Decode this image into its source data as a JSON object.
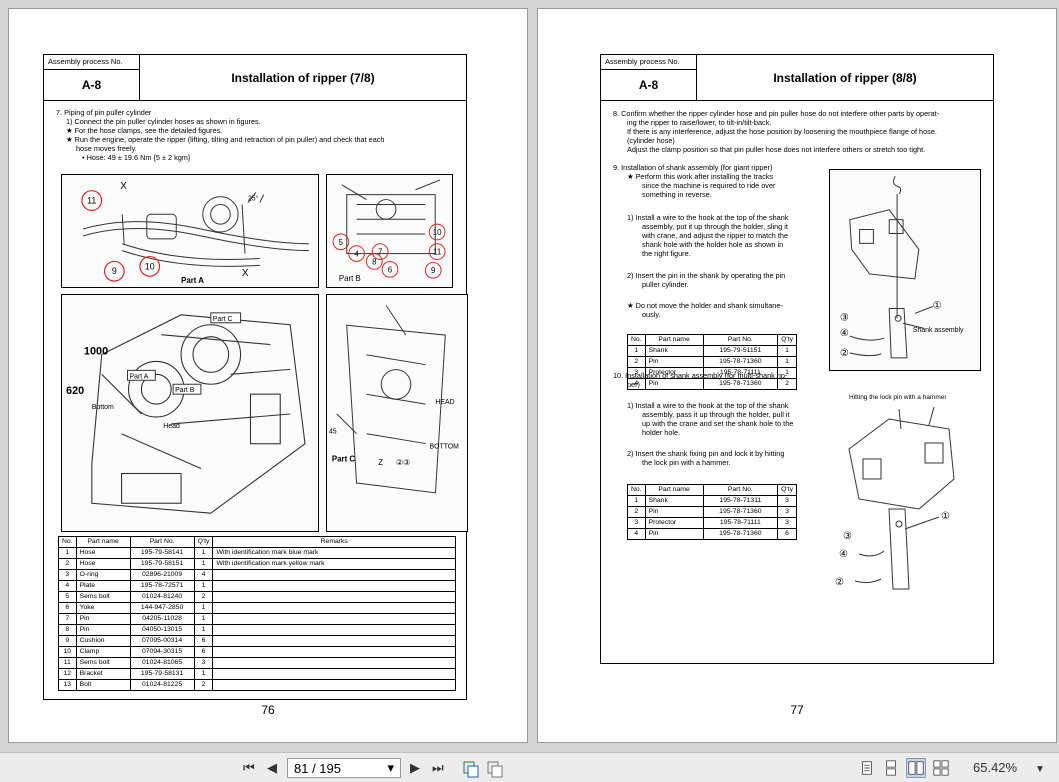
{
  "left_page": {
    "header_label": "Assembly process No.",
    "process_code": "A-8",
    "title": "Installation of ripper (7/8)",
    "step7": {
      "title": "7.   Piping of pin puller cylinder",
      "l1": "1)  Connect the pin puller cylinder hoses as shown in figures.",
      "l2": "★  For the hose clamps, see the detailed figures.",
      "l3": "★  Run the engine, operate the ripper (lifting, tilting and retraction of pin puller) and check that each",
      "l4": "hose moves freely.",
      "l5": "• Hose: 49 ± 19.6 Nm {5 ± 2 kgm}"
    },
    "fig_a": {
      "label": "Part A",
      "x": "X",
      "x2": "X",
      "angle": "25°",
      "c11": "11",
      "c9": "9",
      "c10": "10"
    },
    "fig_b": {
      "label": "Part B",
      "c5": "5",
      "c4": "4",
      "c7": "7",
      "c8": "8",
      "c6": "6",
      "c10": "10",
      "c11": "11",
      "c9": "9"
    },
    "fig_main": {
      "dim1000": "1000",
      "dim620": "620",
      "part_a": "Part A",
      "part_b": "Part B",
      "part_c": "Part C",
      "bottom": "Bottom",
      "head": "Head"
    },
    "fig_c": {
      "label": "Part C",
      "head": "HEAD",
      "bottom": "BOTTOM",
      "z": "Z",
      "n45": "45",
      "nums": "②③"
    },
    "table": {
      "headers": [
        "No.",
        "Part name",
        "Part No.",
        "Q'ty",
        "Remarks"
      ],
      "rows": [
        [
          "1",
          "Hose",
          "195-79-58141",
          "1",
          "With identification mark blue mark"
        ],
        [
          "2",
          "Hose",
          "195-79-58151",
          "1",
          "With identification mark yellow mark"
        ],
        [
          "3",
          "O-ring",
          "02896-21009",
          "4",
          ""
        ],
        [
          "4",
          "Plate",
          "195-78-72571",
          "1",
          ""
        ],
        [
          "5",
          "Sems bolt",
          "01024-81240",
          "2",
          ""
        ],
        [
          "6",
          "Yoke",
          "144-947-2850",
          "1",
          ""
        ],
        [
          "7",
          "Pin",
          "04205-11028",
          "1",
          ""
        ],
        [
          "8",
          "Pin",
          "04050-13015",
          "1",
          ""
        ],
        [
          "9",
          "Cushion",
          "07095-00314",
          "6",
          ""
        ],
        [
          "10",
          "Clamp",
          "07094-30315",
          "6",
          ""
        ],
        [
          "11",
          "Sems bolt",
          "01024-81065",
          "3",
          ""
        ],
        [
          "12",
          "Bracket",
          "195-79-58131",
          "1",
          ""
        ],
        [
          "13",
          "Bolt",
          "01024-81225",
          "2",
          ""
        ]
      ]
    },
    "page_number": "76"
  },
  "right_page": {
    "header_label": "Assembly process No.",
    "process_code": "A-8",
    "title": "Installation of ripper (8/8)",
    "step8": {
      "l1": "8.   Confirm whether the ripper cylinder hose and pin puller hose do not interfere other parts by operat-",
      "l2": "ing the ripper to raise/lower, to tilt-in/tilt-back.",
      "l3": "If there is any interference, adjust the hose position by loosening the mouthpiece flange of hose.",
      "l4": "(cylinder hose)",
      "l5": "Adjust the clamp position so that pin puller hose does not interfere others or stretch too tight."
    },
    "step9": {
      "title": "9.   Installation of shank assembly (for giant ripper)",
      "s1": [
        "★  Perform this work after installing the tracks",
        "since the machine is required to ride over",
        "something in reverse."
      ],
      "s2": [
        "1)  Install a wire to the hook at the top of the shank",
        "assembly, put it up through the holder, sling it",
        "with crane, and adjust the ripper to match the",
        "shank hole with the holder hole as shown in",
        "the right figure."
      ],
      "s3": [
        "2)  Insert the pin in the shank by operating the pin",
        "puller cylinder."
      ],
      "s4": [
        "★  Do not move the holder and shank simultane-",
        "ously."
      ]
    },
    "table1": {
      "headers": [
        "No.",
        "Part name",
        "Part No.",
        "Q'ty"
      ],
      "rows": [
        [
          "1",
          "Shank",
          "195-79-51151",
          "1"
        ],
        [
          "2",
          "Pin",
          "195-78-71360",
          "1"
        ],
        [
          "3",
          "Protector",
          "195-78-71111",
          "1"
        ],
        [
          "4",
          "Pin",
          "195-78-71360",
          "2"
        ]
      ]
    },
    "fig1": {
      "label": "Shank assembly",
      "n1": "①",
      "n2": "②",
      "n3": "③",
      "n4": "④"
    },
    "step10": {
      "title": [
        "10.  Installation of shank assembly (for multi-shank rip-",
        "per)"
      ],
      "s1": [
        "1)  Install a wire to the hook at the top of the shank",
        "assembly, pass it up through the holder, pull it",
        "up with the crane and set the shank hole to the",
        "holder hole."
      ],
      "s2": [
        "2)  Insert the shank fixing pin and lock it by hitting",
        "the lock pin with a hammer."
      ]
    },
    "table2": {
      "headers": [
        "No.",
        "Part name",
        "Part No.",
        "Q'ty"
      ],
      "rows": [
        [
          "1",
          "Shank",
          "195-78-71311",
          "3"
        ],
        [
          "2",
          "Pin",
          "195-78-71360",
          "3"
        ],
        [
          "3",
          "Protector",
          "195-78-71111",
          "3"
        ],
        [
          "4",
          "Pin",
          "195-78-71360",
          "6"
        ]
      ]
    },
    "fig2": {
      "label": "Hitting the lock pin with a hammer",
      "n1": "①",
      "n2": "②",
      "n3": "③",
      "n4": "④"
    },
    "page_number": "77"
  },
  "toolbar": {
    "first": "⏮",
    "prev": "◀",
    "page_value": "81 / 195",
    "dropdown": "▾",
    "next": "▶",
    "last": "⏭",
    "zoom": "65.42%",
    "icons": [
      "first-page-icon",
      "previous-page-icon",
      "next-page-icon",
      "last-page-icon",
      "copy-icon",
      "export-icon",
      "single-page-view-icon",
      "continuous-view-icon",
      "two-page-view-icon",
      "facing-continuous-view-icon",
      "zoom-dropdown-icon"
    ]
  }
}
